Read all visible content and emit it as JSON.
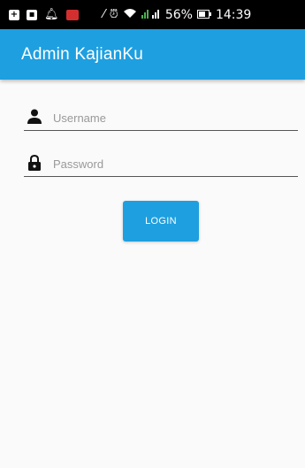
{
  "status_bar": {
    "battery_percent": "56%",
    "time": "14:39",
    "icons": [
      "notification-plus-icon",
      "sim-icon",
      "bell-icon",
      "app-notification-icon",
      "mute-icon",
      "alarm-icon",
      "wifi-icon",
      "signal-icon",
      "battery-icon"
    ]
  },
  "app_bar": {
    "title": "Admin KajianKu",
    "color": "#1e9fe0"
  },
  "form": {
    "username": {
      "placeholder": "Username",
      "value": "",
      "icon": "person-icon"
    },
    "password": {
      "placeholder": "Password",
      "value": "",
      "icon": "lock-icon"
    },
    "login_label": "LOGIN"
  }
}
